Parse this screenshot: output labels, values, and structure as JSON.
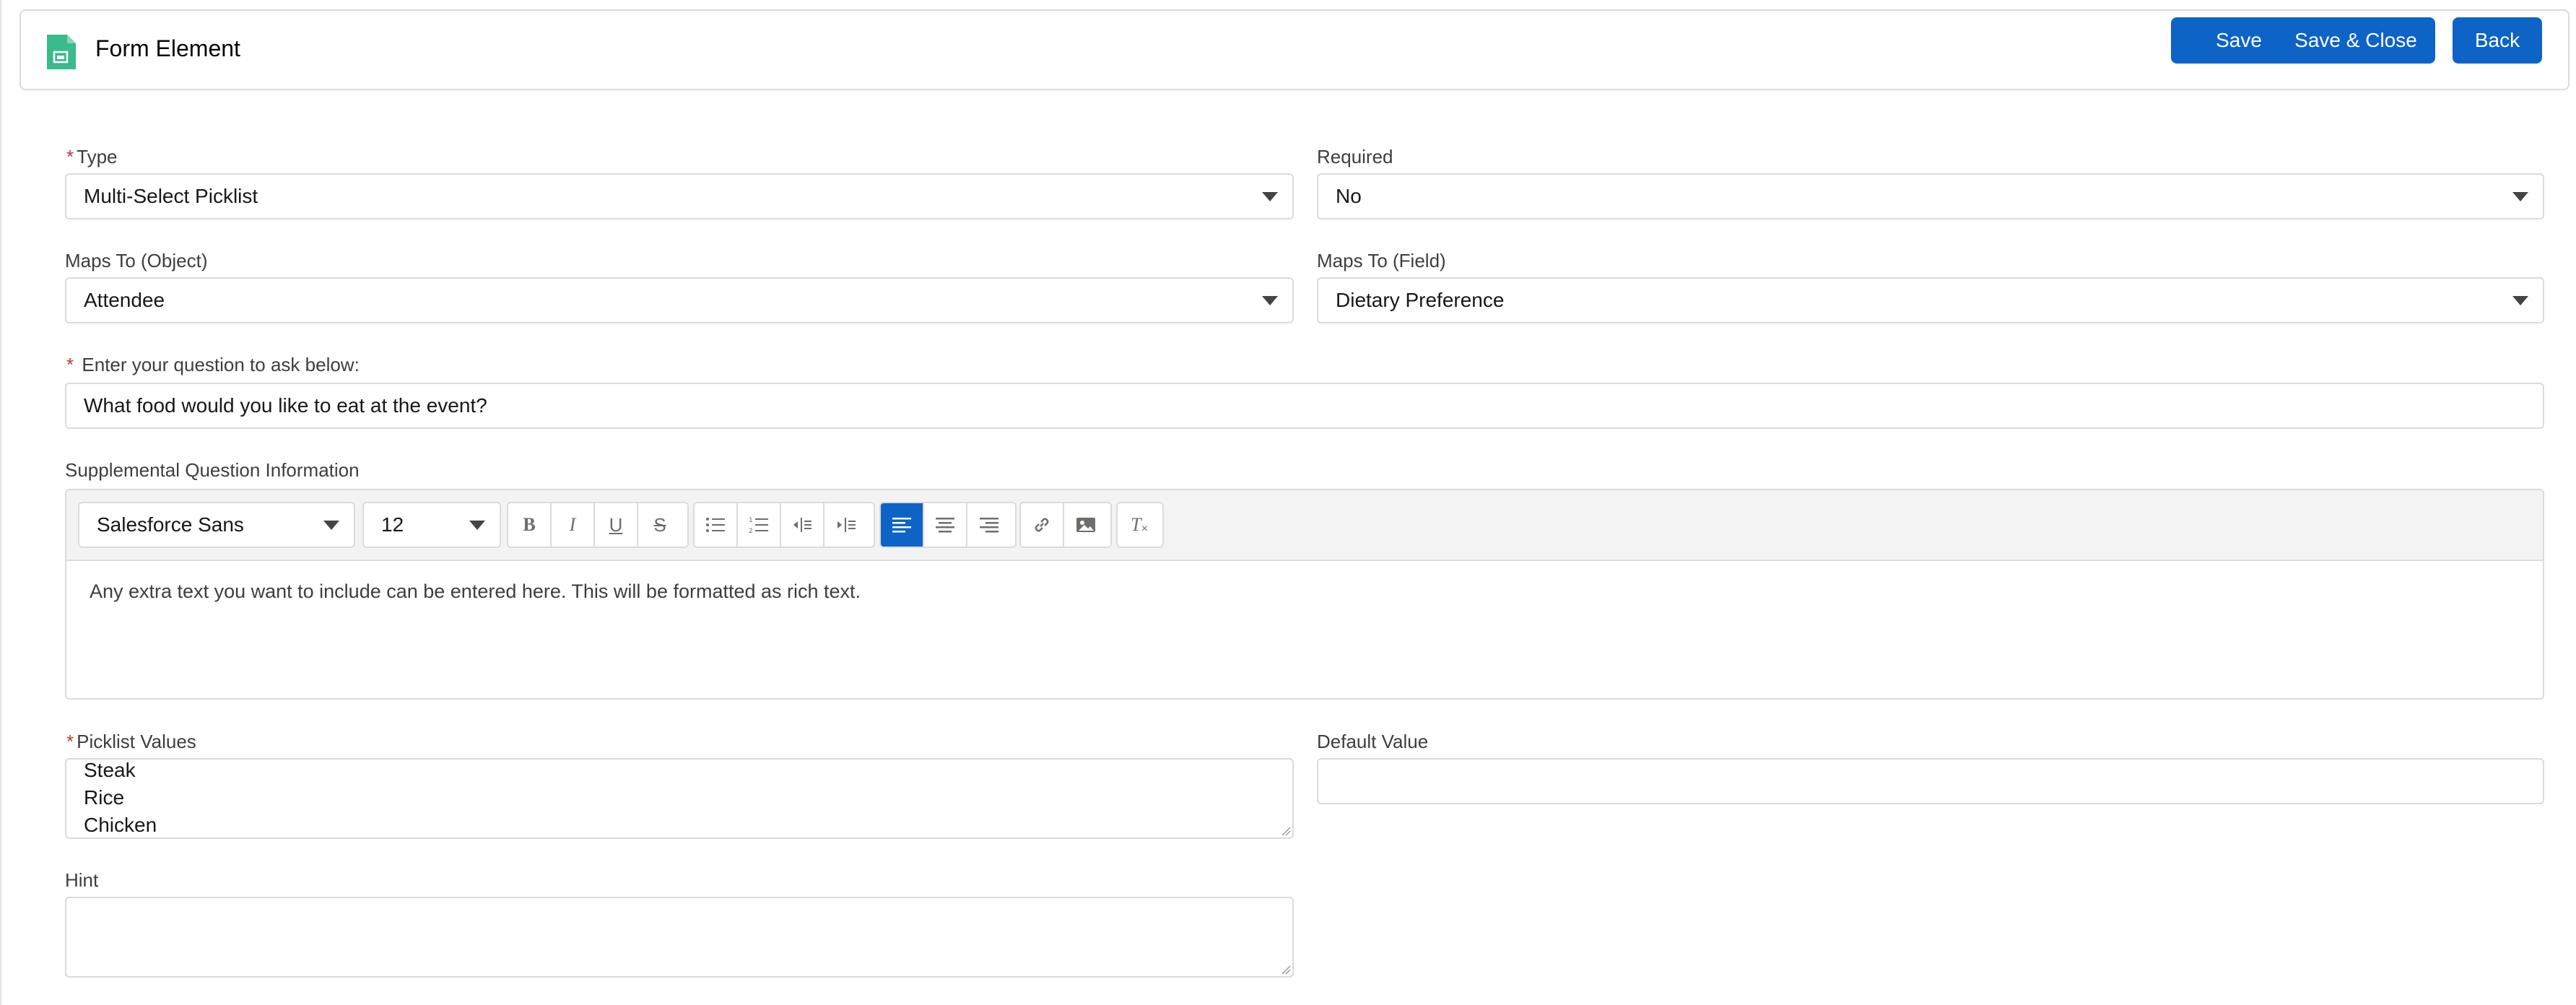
{
  "header": {
    "title": "Form Element",
    "icon": "form-document-icon",
    "icon_color": "#3bba8c",
    "buttons": {
      "save": "Save",
      "save_close": "Save & Close",
      "back": "Back"
    }
  },
  "colors": {
    "brand": "#0e63c7",
    "required": "#c23934",
    "border": "#dddbda"
  },
  "form": {
    "type": {
      "label": "Type",
      "required_mark": "*",
      "value": "Multi-Select Picklist"
    },
    "required": {
      "label": "Required",
      "value": "No"
    },
    "maps_to_object": {
      "label": "Maps To (Object)",
      "value": "Attendee"
    },
    "maps_to_field": {
      "label": "Maps To (Field)",
      "value": "Dietary Preference"
    },
    "question": {
      "label": "Enter your question to ask below:",
      "required_mark": "*",
      "value": "What food would you like to eat at the event?"
    },
    "supplemental": {
      "label": "Supplemental Question Information",
      "font_family": "Salesforce Sans",
      "font_size": "12",
      "body": "Any extra text you want to include can be entered here. This will be formatted as rich text.",
      "toolbar_icons": [
        "bold-icon",
        "italic-icon",
        "underline-icon",
        "strikethrough-icon",
        "bullet-list-icon",
        "numbered-list-icon",
        "indent-icon",
        "outdent-icon",
        "align-left-icon",
        "align-center-icon",
        "align-right-icon",
        "link-icon",
        "image-icon",
        "clear-format-icon"
      ],
      "bold_glyph": "B",
      "italic_glyph": "I",
      "underline_glyph": "U",
      "strike_glyph": "S",
      "clear_glyph": "T"
    },
    "picklist_values": {
      "label": "Picklist Values",
      "required_mark": "*",
      "values": [
        "Steak",
        "Rice",
        "Chicken"
      ]
    },
    "default_value": {
      "label": "Default Value",
      "value": ""
    },
    "hint": {
      "label": "Hint",
      "value": ""
    }
  }
}
